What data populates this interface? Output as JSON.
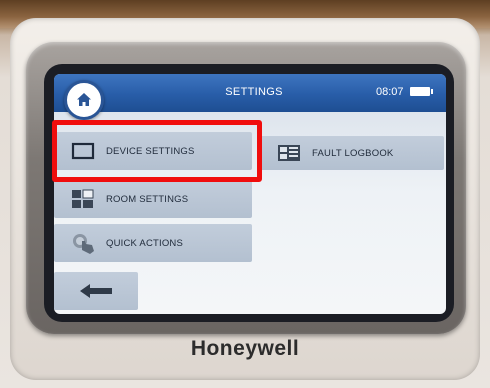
{
  "header": {
    "title": "SETTINGS",
    "time": "08:07"
  },
  "menu": {
    "device_settings": "DEVICE SETTINGS",
    "fault_logbook": "FAULT LOGBOOK",
    "room_settings": "ROOM SETTINGS",
    "quick_actions": "QUICK ACTIONS"
  },
  "brand": "Honeywell",
  "icons": {
    "home": "home-icon",
    "battery": "battery-icon",
    "back": "back-arrow-icon"
  },
  "colors": {
    "topbar": "#285da8",
    "button": "#b8c4d3",
    "highlight": "#f00d0d"
  }
}
